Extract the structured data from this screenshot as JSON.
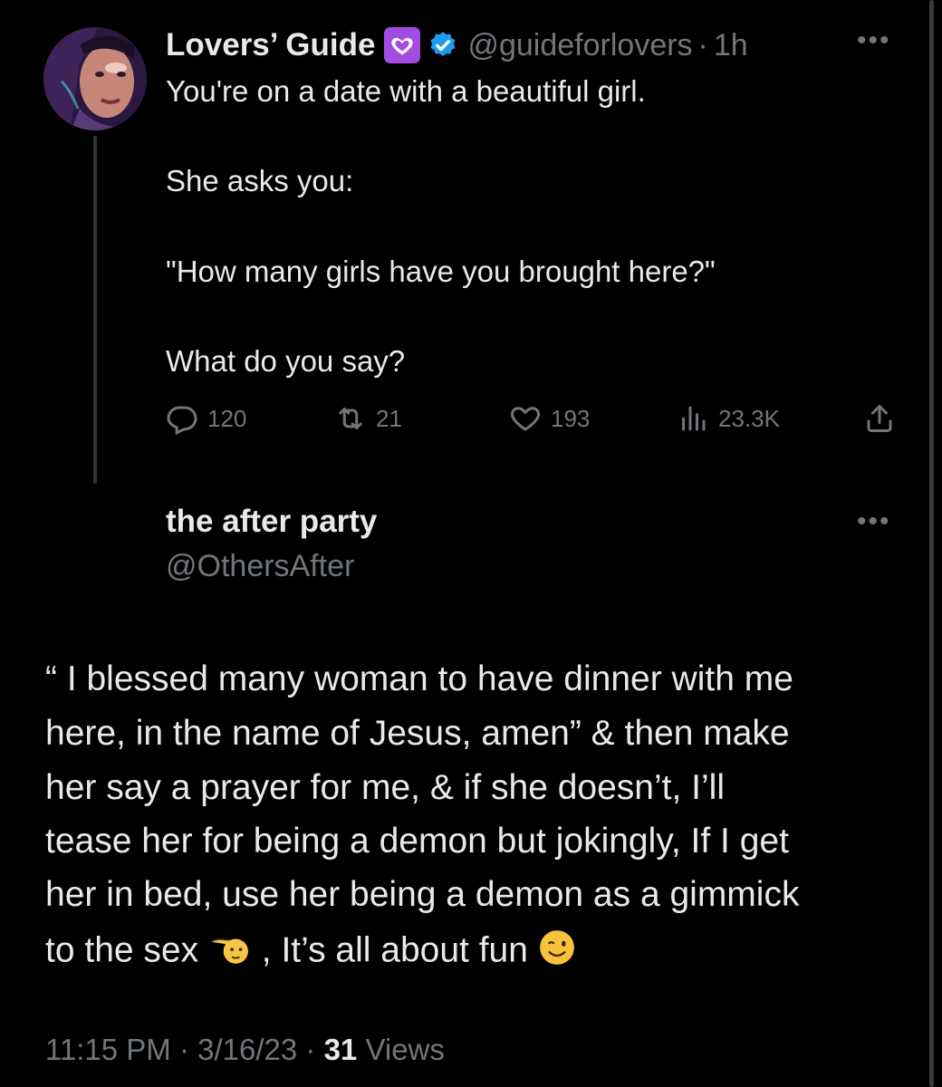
{
  "tweet": {
    "display_name": "Lovers’ Guide",
    "badge_icon": "purple-heart-icon",
    "verified_icon": "verified-badge-icon",
    "handle": "@guideforlovers",
    "separator": "·",
    "time_ago": "1h",
    "more": "•••",
    "lines": [
      "You're on a date with a beautiful girl.",
      "She asks you:",
      "\"How many girls have you brought here?\"",
      "What do you say?"
    ],
    "stats": {
      "replies": "120",
      "retweets": "21",
      "likes": "193",
      "views": "23.3K"
    }
  },
  "reply": {
    "display_name": "the after party",
    "handle": "@OthersAfter",
    "more": "•••",
    "lines": [
      "“ I blessed many woman to have dinner with me",
      "here, in the name of Jesus, amen” & then make",
      "her say a prayer for me, & if she doesn’t, I’ll",
      "tease her for being a demon but jokingly, If I get",
      "her in bed, use her being a demon as a gimmick",
      "to the sex"
    ],
    "last_line_tail": ", It’s all about fun",
    "emoji_1": "🫵",
    "emoji_2": "😉",
    "timestamp": "11:15 PM · 3/16/23 · ",
    "views_count": "31",
    "views_label": " Views"
  },
  "colors": {
    "background": "#000000",
    "text": "#e7e9ea",
    "muted": "#71767b",
    "verified": "#1d9bf0",
    "heart_badge": "#a24ce0"
  }
}
